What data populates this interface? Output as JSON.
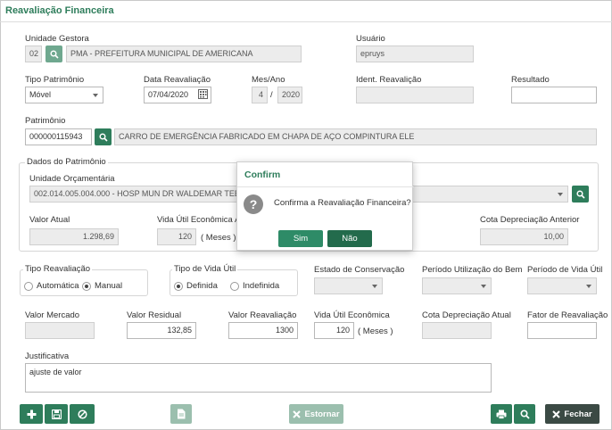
{
  "page": {
    "title": "Reavaliação Financeira"
  },
  "unidade_gestora": {
    "label": "Unidade Gestora",
    "code": "02",
    "name": "PMA - PREFEITURA MUNICIPAL DE AMERICANA"
  },
  "usuario": {
    "label": "Usuário",
    "value": "epruys"
  },
  "tipo_patrimonio": {
    "label": "Tipo Patrimônio",
    "value": "Móvel"
  },
  "data_reavaliacao": {
    "label": "Data Reavaliação",
    "value": "07/04/2020"
  },
  "mes_ano": {
    "label": "Mes/Ano",
    "mes": "4",
    "sep": "/",
    "ano": "2020"
  },
  "ident_reavaliacao": {
    "label": "Ident. Reavalição",
    "value": ""
  },
  "resultado": {
    "label": "Resultado",
    "value": ""
  },
  "patrimonio": {
    "label": "Patrimônio",
    "code": "000000115943",
    "desc": "CARRO DE EMERGÊNCIA FABRICADO EM CHAPA DE AÇO COMPINTURA ELE"
  },
  "dados_patrimonio": {
    "legend": "Dados do Patrimônio",
    "unidade_orc_label": "Unidade Orçamentária",
    "unidade_orc_value": "002.014.005.004.000 - HOSP MUN DR WALDEMAR TEBALDI -",
    "valor_atual_label": "Valor Atual",
    "valor_atual": "1.298,69",
    "vida_util_label": "Vida Útil Econômica An",
    "vida_util": "120",
    "vida_util_unit": "( Meses )",
    "cota_anterior_label": "Cota Depreciação Anterior",
    "cota_anterior": "10,00"
  },
  "tipo_reavaliacao": {
    "label": "Tipo Reavaliação",
    "opt1": "Automática",
    "opt2": "Manual",
    "selected": "Manual"
  },
  "tipo_vida_util": {
    "label": "Tipo de Vida Útil",
    "opt1": "Definida",
    "opt2": "Indefinida",
    "selected": "Definida"
  },
  "estado_conservacao": {
    "label": "Estado de Conservação",
    "value": ""
  },
  "periodo_utilizacao": {
    "label": "Período Utilização do Bem",
    "value": ""
  },
  "periodo_vida_util": {
    "label": "Período de Vida Útil",
    "value": ""
  },
  "valor_mercado": {
    "label": "Valor Mercado",
    "value": ""
  },
  "valor_residual": {
    "label": "Valor Residual",
    "value": "132,85"
  },
  "valor_reavaliacao": {
    "label": "Valor Reavaliação",
    "value": "1300"
  },
  "vida_util_economica": {
    "label": "Vida Útil Econômica",
    "value": "120",
    "unit": "( Meses )"
  },
  "cota_atual": {
    "label": "Cota Depreciação Atual",
    "value": ""
  },
  "fator_reavaliacao": {
    "label": "Fator de Reavaliação",
    "value": ""
  },
  "justificativa": {
    "label": "Justificativa",
    "value": "ajuste de valor"
  },
  "toolbar": {
    "estornar": "Estornar",
    "fechar": "Fechar"
  },
  "dialog": {
    "title": "Confirm",
    "message": "Confirma a Reavaliação Financeira?",
    "yes": "Sim",
    "no": "Não"
  },
  "colors": {
    "accent": "#2e7d5b",
    "dark": "#3b4a44"
  }
}
